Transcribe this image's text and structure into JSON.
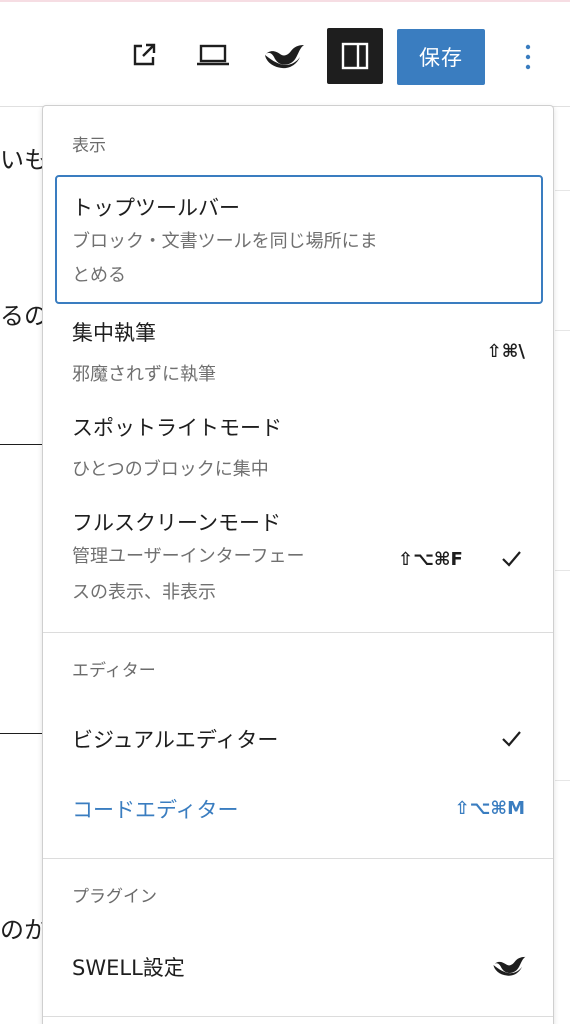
{
  "toolbar": {
    "external_link_icon": "external-link-icon",
    "preview_icon": "laptop-icon",
    "swell_icon": "swell-logo-icon",
    "sidebar_icon": "sidebar-toggle-icon",
    "save_label": "保存",
    "options_icon": "more-vertical-icon",
    "accent_color": "#3a7dc0"
  },
  "background": {
    "line1": "いも",
    "line2": "るの",
    "line3": "のか"
  },
  "menu": {
    "view": {
      "label": "表示",
      "items": [
        {
          "title": "トップツールバー",
          "desc_line1": "ブロック・文書ツールを同じ場所にま",
          "desc_line2": "とめる",
          "shortcut": "",
          "checked": false
        },
        {
          "title": "集中執筆",
          "desc_line1": "邪魔されずに執筆",
          "shortcut": "⇧⌘\\",
          "checked": false
        },
        {
          "title": "スポットライトモード",
          "desc_line1": "ひとつのブロックに集中",
          "shortcut": "",
          "checked": false
        },
        {
          "title": "フルスクリーンモード",
          "desc_line1": "管理ユーザーインターフェー",
          "desc_line2": "スの表示、非表示",
          "shortcut": "⇧⌥⌘F",
          "checked": true
        }
      ]
    },
    "editor": {
      "label": "エディター",
      "items": [
        {
          "title": "ビジュアルエディター",
          "shortcut": "",
          "checked": true
        },
        {
          "title": "コードエディター",
          "shortcut": "⇧⌥⌘M",
          "checked": false
        }
      ]
    },
    "plugins": {
      "label": "プラグイン",
      "items": [
        {
          "title": "SWELL設定",
          "icon": "swell-logo-icon"
        }
      ]
    }
  }
}
